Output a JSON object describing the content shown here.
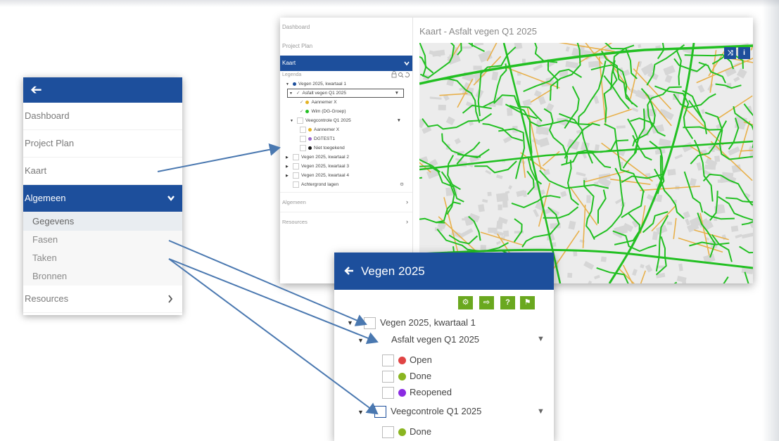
{
  "left_panel": {
    "back_glyph": "➔",
    "items": [
      "Dashboard",
      "Project Plan",
      "Kaart"
    ],
    "active_group": "Algemeen",
    "subitems": [
      "Gegevens",
      "Fasen",
      "Taken",
      "Bronnen"
    ],
    "resources": "Resources"
  },
  "window": {
    "side": {
      "dashboard": "Dashboard",
      "project_plan": "Project Plan",
      "kaart": "Kaart",
      "legenda": "Legenda",
      "tree": {
        "k1": "Vegen 2025, kwartaal 1",
        "asfalt": "Asfalt vegen Q1 2025",
        "aannemer_x": "Aannemer X",
        "wim": "Wim (DG-Groep)",
        "veegcontrole": "Veegcontrole Q1 2025",
        "aannemer_x2": "Aannemer X",
        "dgtest": "DGTEST1",
        "niet": "Niet toegekend",
        "k2": "Vegen 2025, kwartaal 2",
        "k3": "Vegen 2025, kwartaal 3",
        "k4": "Vegen 2025, kwartaal 4",
        "achtergrond": "Achtergrond lagen"
      },
      "algemeen": "Algemeen",
      "resources": "Resources"
    },
    "title": "Kaart - Asfalt vegen Q1 2025",
    "map_buttons": [
      "⤨",
      "i"
    ]
  },
  "bottom_panel": {
    "title": "Vegen 2025",
    "tools": [
      "⚙",
      "⇨",
      "?",
      "⚑"
    ],
    "rows": {
      "k1": "Vegen 2025, kwartaal 1",
      "asfalt": "Asfalt vegen Q1 2025",
      "open": "Open",
      "done": "Done",
      "reopened": "Reopened",
      "veeg": "Veegcontrole Q1 2025",
      "done2": "Done"
    }
  },
  "colors": {
    "brand_blue": "#1d4f9c",
    "tool_green": "#6aa81f",
    "road_green": "#22c022",
    "road_orange": "#e8b04a",
    "dot_red": "#e04444",
    "dot_green": "#8ab520",
    "dot_purple": "#8a2be2",
    "dot_yellow": "#e3b223",
    "arrow": "#4a78b0"
  }
}
